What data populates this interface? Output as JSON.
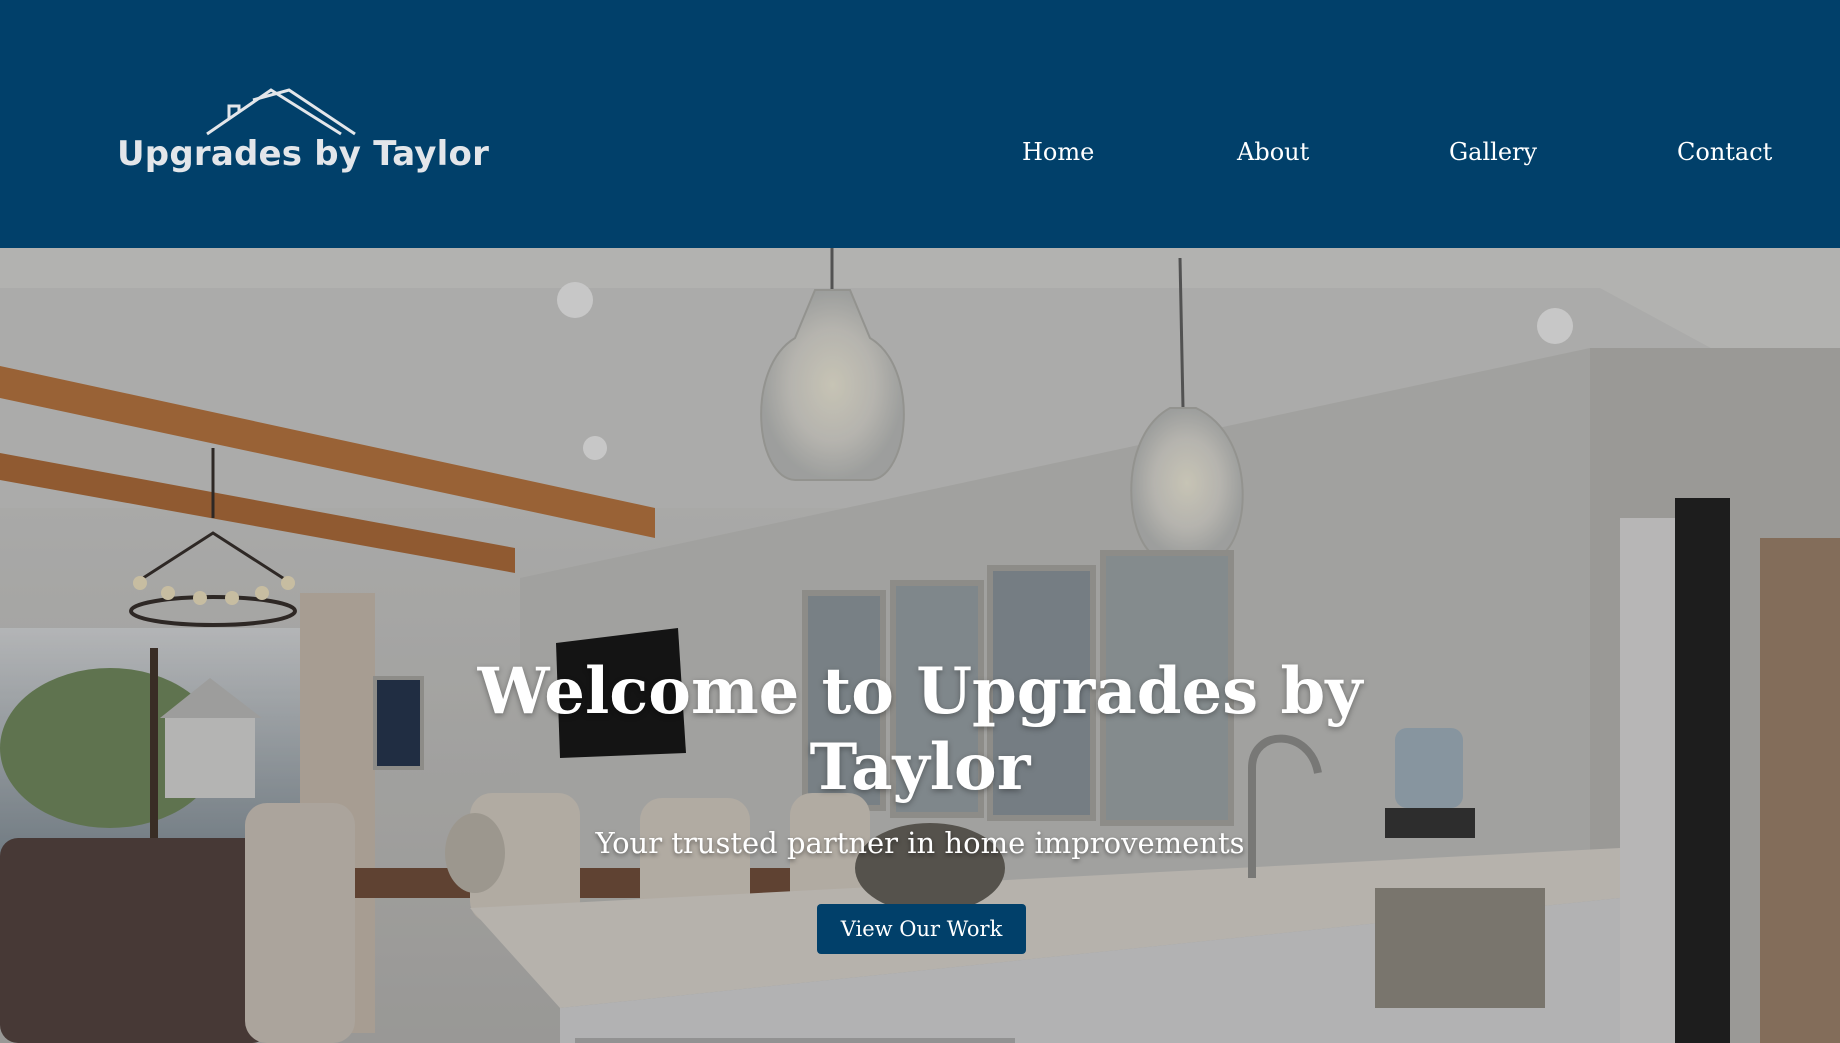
{
  "brand": {
    "name": "Upgrades by Taylor",
    "logo_icon": "house-roof-icon"
  },
  "nav": {
    "items": [
      {
        "label": "Home"
      },
      {
        "label": "About"
      },
      {
        "label": "Gallery"
      },
      {
        "label": "Contact"
      }
    ]
  },
  "hero": {
    "title": "Welcome to Upgrades by Taylor",
    "subtitle": "Your trusted partner in home improvements",
    "cta_label": "View Our Work"
  },
  "colors": {
    "brand_navy": "#01406a",
    "text_light": "#ffffff"
  }
}
